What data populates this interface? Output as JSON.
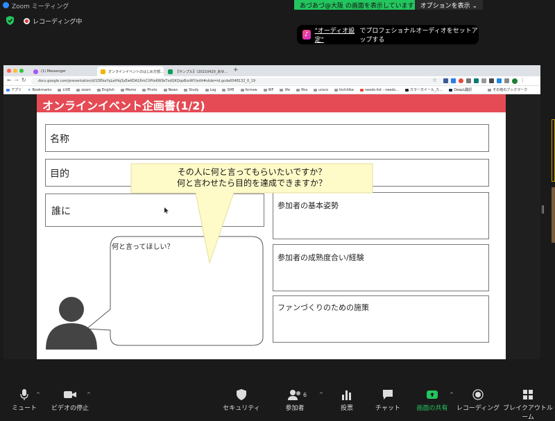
{
  "zoom": {
    "window_title": "Zoom ミーティング",
    "share_banner": {
      "sharing_text": "あづあづ@大阪 の画面を表示しています",
      "options_label": "オプションを表示 ⌄"
    },
    "recording_label": "レコーディング中",
    "audio_notice": {
      "link": "\"オーディオ設定\"",
      "text": "でプロフェショナルオーディオをセットアップする"
    },
    "toolbar": {
      "mute": "ミュート",
      "video": "ビデオの停止",
      "security": "セキュリティ",
      "participants": "参加者",
      "participant_count": "6",
      "polls": "投票",
      "chat": "チャット",
      "share": "画面の共有",
      "record": "レコーディング",
      "breakout": "ブレイクアウトルーム"
    }
  },
  "browser": {
    "tabs": [
      {
        "label": "(1) Messenger",
        "active": false,
        "color": "#a855f7"
      },
      {
        "label": "オンラインイベントのはじめ方部...",
        "active": true,
        "color": "#f4b400"
      },
      {
        "label": "【サンプル】（20210420_あゆ...",
        "active": false,
        "color": "#0f9d58"
      }
    ],
    "new_tab": "+",
    "url": "docs.google.com/presentation/d/1DEkaYqLetHq3yEwKDA1RmCXPtoKW9sTxdQKQqoBzsWY/edit#slide=id.gcda0048132_0_19",
    "bookmarks": [
      "アプリ",
      "Bookmarks",
      "LIVE",
      "zoom",
      "English",
      "Memo",
      "Photo",
      "News",
      "Study",
      "Log",
      "SHE",
      "fornow",
      "WF",
      "life",
      "fika",
      "uroco",
      "kichitike",
      "needs-list - needs...",
      "カラーホイール_た...",
      "DeepL翻訳"
    ],
    "other_bookmarks": "その他のブックマーク"
  },
  "slide": {
    "title": "オンラインイベント企画書(1/2)",
    "rows": {
      "name": "名称",
      "purpose": "目的",
      "target": "誰に"
    },
    "callout": {
      "line1": "その人に何と言ってもらいたいですか？",
      "line2": "何と言わせたら目的を達成できますか？"
    },
    "speech_bubble": "何と言ってほしい？",
    "right_boxes": [
      "参加者の基本姿勢",
      "参加者の成熟度合い/経験",
      "ファンづくりのための施策"
    ]
  }
}
